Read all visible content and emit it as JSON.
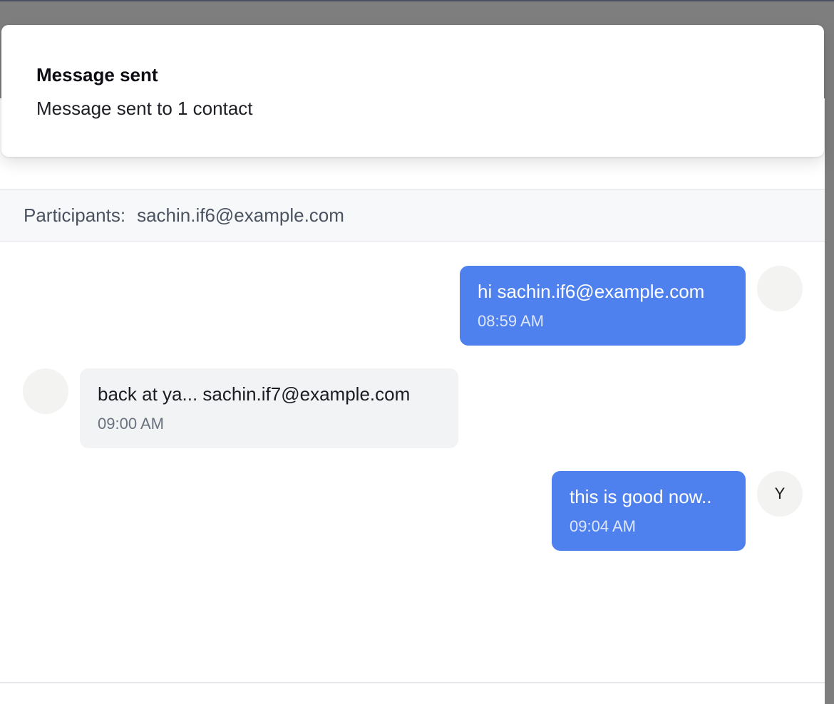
{
  "toast": {
    "title": "Message sent",
    "description": "Message sent to 1 contact"
  },
  "participants": {
    "label": "Participants:",
    "value": "sachin.if6@example.com"
  },
  "messages": [
    {
      "direction": "outgoing",
      "text": "hi sachin.if6@example.com",
      "time": "08:59 AM",
      "avatar": ""
    },
    {
      "direction": "incoming",
      "text": "back at ya... sachin.if7@example.com",
      "time": "09:00 AM",
      "avatar": ""
    },
    {
      "direction": "outgoing",
      "text": "this is good now..",
      "time": "09:04 AM",
      "avatar": "Y"
    }
  ],
  "colors": {
    "outgoing_bubble": "#4f81ee",
    "incoming_bubble": "#f2f3f5",
    "overlay": "#7e7e7e"
  }
}
